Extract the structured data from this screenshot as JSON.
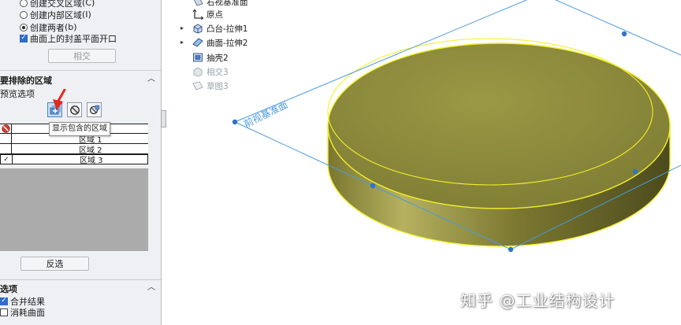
{
  "region_options": {
    "radio1": "创建交叉区域",
    "radio1_key": "(C)",
    "radio2": "创建内部区域",
    "radio2_key": "(I)",
    "radio3": "创建两者",
    "radio3_key": "(b)",
    "cap_check": "曲面上的封盖平面开口",
    "intersect_button": "相交"
  },
  "exclude": {
    "title": "要排除的区域",
    "preview_label": "预览选项",
    "tooltip": "显示包含的区域",
    "rows": [
      {
        "label": "区域  1",
        "checked": ""
      },
      {
        "label": "区域  2",
        "checked": ""
      },
      {
        "label": "区域  3",
        "checked": "✓"
      }
    ],
    "invert_button": "反选"
  },
  "options": {
    "title": "选项",
    "merge": "合并结果",
    "consume": "消耗曲面"
  },
  "tree": {
    "items": [
      {
        "label": "右视基准面"
      },
      {
        "label": "原点"
      },
      {
        "label": "凸台-拉伸1"
      },
      {
        "label": "曲面-拉伸2"
      },
      {
        "label": "抽壳2"
      },
      {
        "label": "相交3"
      },
      {
        "label": "草图3"
      }
    ]
  },
  "viewport": {
    "plane_label": "前视基准面",
    "model_color": "#8f8d3c",
    "edge_color": "#f3f02a",
    "plane_color": "#4a9ae0"
  },
  "watermark": "知乎 @工业结构设计"
}
